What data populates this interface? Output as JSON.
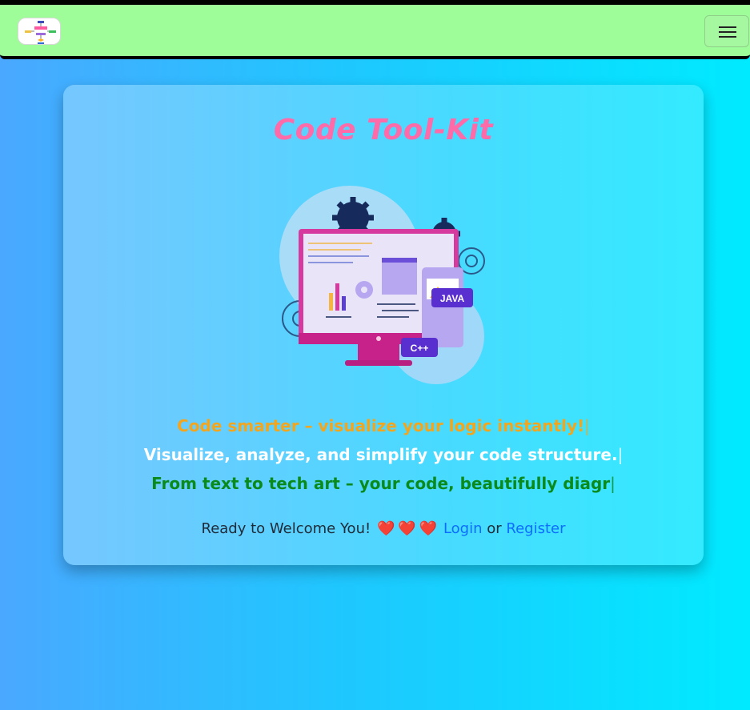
{
  "app": {
    "logo_icon": "flowchart-logo-icon",
    "menu_icon": "hamburger-menu-icon"
  },
  "hero": {
    "title": "Code Tool-Kit",
    "illustration": {
      "icon": "computer-code-illustration-icon",
      "badge_java": "JAVA",
      "badge_cpp": "C++"
    },
    "taglines": [
      {
        "text": "Code smarter – visualize your logic instantly!",
        "cursor": "|",
        "color": "#f3a51e"
      },
      {
        "text": "Visualize, analyze, and simplify your code structure.",
        "cursor": "|",
        "color": "#ffffff"
      },
      {
        "text": "From text to tech art – your code, beautifully diagr",
        "cursor": "|",
        "color": "#0b8a1c"
      }
    ],
    "welcome": {
      "text": "Ready to Welcome You!",
      "hearts": [
        "❤️",
        "❤️",
        "❤️"
      ],
      "login": "Login",
      "or": "or",
      "register": "Register"
    }
  },
  "colors": {
    "navbar": "#9efd99",
    "title": "#ff6aa8",
    "link": "#0d6efd"
  }
}
